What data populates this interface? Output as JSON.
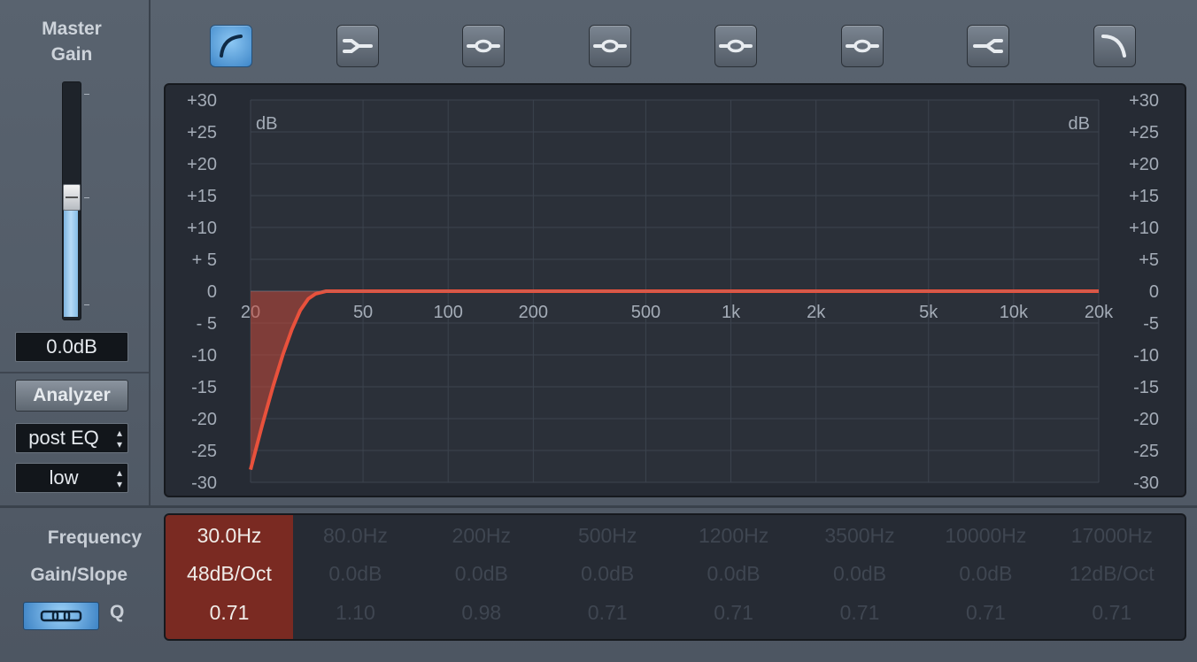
{
  "master": {
    "title_line1": "Master",
    "title_line2": "Gain",
    "value": "0.0dB",
    "level_fraction": 0.47
  },
  "analyzer": {
    "button_label": "Analyzer",
    "mode": "post EQ",
    "resolution": "low"
  },
  "band_buttons": [
    {
      "icon": "low-cut-icon",
      "active": true
    },
    {
      "icon": "low-shelf-icon",
      "active": false
    },
    {
      "icon": "parametric-bell-icon",
      "active": false
    },
    {
      "icon": "parametric-bell-icon",
      "active": false
    },
    {
      "icon": "parametric-bell-icon",
      "active": false
    },
    {
      "icon": "parametric-bell-icon",
      "active": false
    },
    {
      "icon": "high-shelf-icon",
      "active": false
    },
    {
      "icon": "high-cut-icon",
      "active": false
    }
  ],
  "graph": {
    "db_unit_left": "dB",
    "db_unit_right": "dB",
    "db_labels_left": [
      "+30",
      "+25",
      "+20",
      "+15",
      "+10",
      "+ 5",
      "0",
      "- 5",
      "-10",
      "-15",
      "-20",
      "-25",
      "-30"
    ],
    "db_labels_right": [
      "+30",
      "+25",
      "+20",
      "+15",
      "+10",
      "+5",
      "0",
      "-5",
      "-10",
      "-15",
      "-20",
      "-25",
      "-30"
    ],
    "freq_labels": [
      "20",
      "50",
      "100",
      "200",
      "500",
      "1k",
      "2k",
      "5k",
      "10k",
      "20k"
    ],
    "curve": {
      "color": "#e8513c",
      "points": [
        [
          20,
          -28
        ],
        [
          22,
          -21
        ],
        [
          24,
          -15
        ],
        [
          26,
          -10
        ],
        [
          28,
          -6
        ],
        [
          30,
          -3
        ],
        [
          32,
          -1.2
        ],
        [
          34,
          -0.4
        ],
        [
          37,
          0
        ],
        [
          20000,
          0
        ]
      ]
    }
  },
  "bottom": {
    "frequency_label": "Frequency",
    "gain_label": "Gain/Slope",
    "q_label": "Q"
  },
  "bands": [
    {
      "freq": "30.0Hz",
      "gain": "48dB/Oct",
      "q": "0.71",
      "active": true
    },
    {
      "freq": "80.0Hz",
      "gain": "0.0dB",
      "q": "1.10",
      "active": false
    },
    {
      "freq": "200Hz",
      "gain": "0.0dB",
      "q": "0.98",
      "active": false
    },
    {
      "freq": "500Hz",
      "gain": "0.0dB",
      "q": "0.71",
      "active": false
    },
    {
      "freq": "1200Hz",
      "gain": "0.0dB",
      "q": "0.71",
      "active": false
    },
    {
      "freq": "3500Hz",
      "gain": "0.0dB",
      "q": "0.71",
      "active": false
    },
    {
      "freq": "10000Hz",
      "gain": "0.0dB",
      "q": "0.71",
      "active": false
    },
    {
      "freq": "17000Hz",
      "gain": "12dB/Oct",
      "q": "0.71",
      "active": false
    }
  ],
  "colors": {
    "accent_blue": "#5aa3e0",
    "curve_red": "#e8513c",
    "active_band_bg": "#7a2a22"
  }
}
